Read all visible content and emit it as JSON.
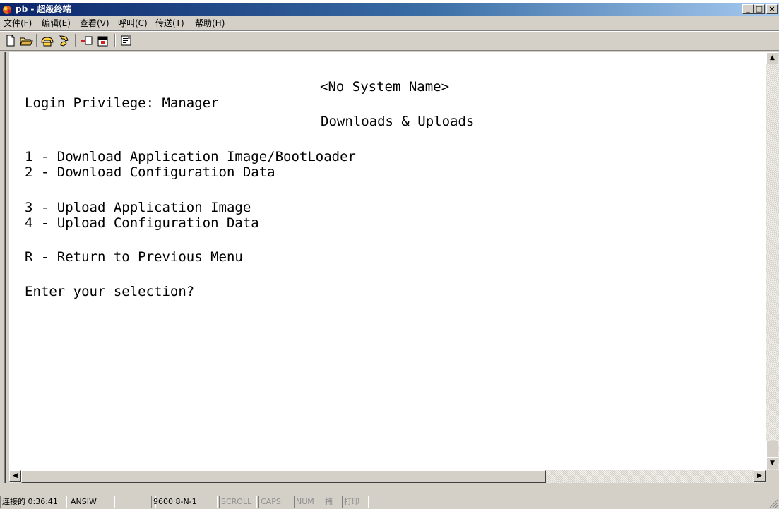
{
  "window": {
    "title": "pb - 超级终端",
    "minimize_glyph": "_",
    "maximize_glyph": "□",
    "close_glyph": "×"
  },
  "menu": [
    "文件(F)",
    "编辑(E)",
    "查看(V)",
    "呼叫(C)",
    "传送(T)",
    "帮助(H)"
  ],
  "toolbar_icons": [
    "new-connection-icon",
    "open-icon",
    "connect-icon",
    "disconnect-icon",
    "send-icon",
    "receive-icon",
    "properties-icon"
  ],
  "terminal": {
    "system_name": "<No System Name>",
    "privilege": "Login Privilege: Manager",
    "menu_title": "Downloads & Uploads",
    "options": [
      "1 - Download Application Image/BootLoader",
      "2 - Download Configuration Data",
      "3 - Upload Application Image",
      "4 - Upload Configuration Data",
      "R - Return to Previous Menu"
    ],
    "prompt": "Enter your selection?"
  },
  "status": {
    "connected": "连接的 0:36:41",
    "emulation": "ANSIW",
    "port_settings": "9600 8-N-1",
    "scroll": "SCROLL",
    "caps": "CAPS",
    "num": "NUM",
    "capture": "捕",
    "print": "打印"
  },
  "colors": {
    "title_active": "#0a246a",
    "title_gradient_end": "#a6caf0",
    "chrome": "#d4d0c8",
    "terminal_bg": "#ffffff",
    "terminal_text": "#000000"
  }
}
